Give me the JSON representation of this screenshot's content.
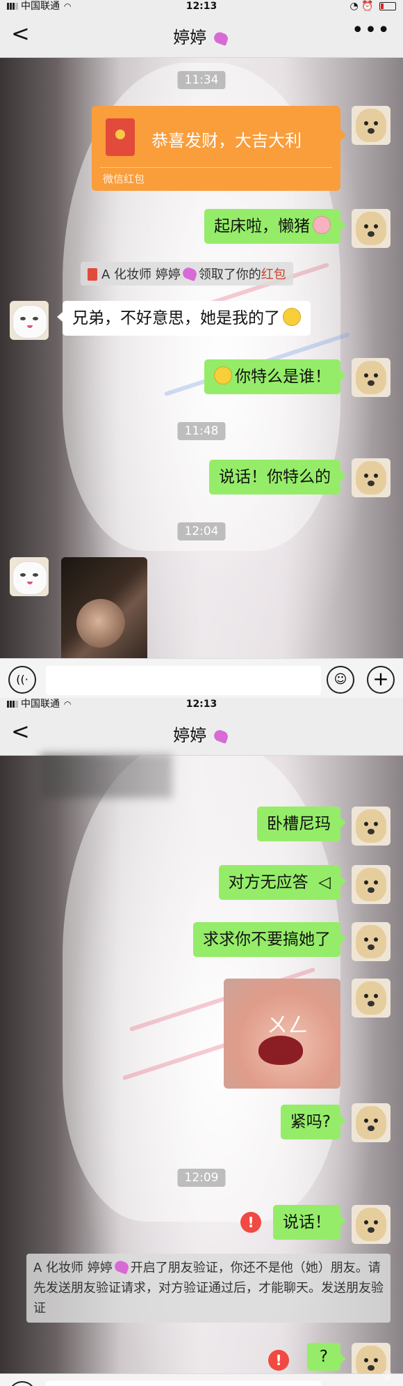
{
  "status_bar": {
    "carrier": "中国联通",
    "time": "12:13"
  },
  "nav": {
    "back": "<",
    "title": "婷婷",
    "more": "•••"
  },
  "screen1": {
    "time1": "11:34",
    "red_packet": {
      "message": "恭喜发财，大吉大利",
      "footer": "微信红包"
    },
    "msg_wake": "起床啦，懒猪",
    "notice_claim": {
      "before": "A 化妆师 婷婷",
      "middle": "领取了你的",
      "link": "红包"
    },
    "msg_left1": "兄弟，不好意思，她是我的了",
    "msg_who": "你特么是谁！",
    "time2": "11:48",
    "msg_speak": "说话！你特么的",
    "time3": "12:04"
  },
  "screen2": {
    "msg_1": "卧槽尼玛",
    "msg_2": "对方无应答",
    "msg_2_icon": "◁",
    "msg_3": "求求你不要搞她了",
    "sticker_text": "ㄨㄥ",
    "msg_4": "紧吗?",
    "time4": "12:09",
    "msg_5": "说话！",
    "alert": "!",
    "verify_notice": {
      "before": "A 化妆师 婷婷",
      "text": "开启了朋友验证，你还不是他（她）朋友。请先发送朋友验证请求，对方验证通过后，才能聊天。",
      "link": "发送朋友验证"
    },
    "msg_6": "?",
    "watermark": "@"
  },
  "input_bar": {
    "voice_icon": "((·",
    "emoji_icon": "☺",
    "plus_icon": "+"
  },
  "colors": {
    "green_bubble": "#95ec69",
    "red_packet": "#fa9d3b",
    "nav_bg": "#ededed",
    "alert": "#f04a43"
  }
}
